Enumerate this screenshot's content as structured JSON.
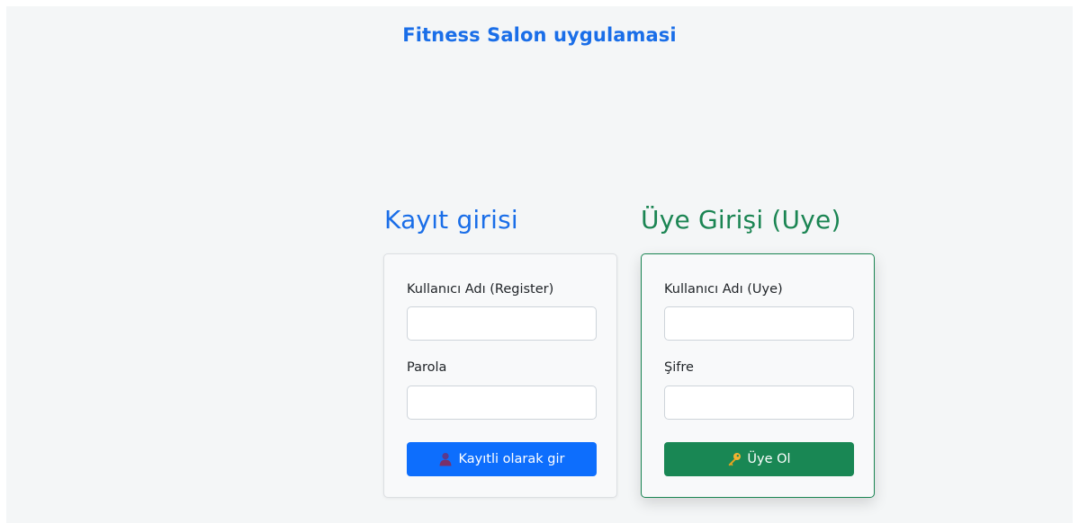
{
  "app": {
    "title": "Fitness Salon uygulamasi"
  },
  "register": {
    "heading": "Kayıt girisi",
    "username_label": "Kullanıcı Adı (Register)",
    "username_value": "",
    "password_label": "Parola",
    "password_value": "",
    "button_label": "Kayıtli olarak gir",
    "button_icon": "user-icon"
  },
  "member": {
    "heading": "Üye Girişi (Uye)",
    "username_label": "Kullanıcı Adı (Uye)",
    "username_value": "",
    "password_label": "Şifre",
    "password_value": "",
    "button_label": "Üye Ol",
    "button_icon": "key-icon"
  },
  "colors": {
    "primary_blue": "#0d6efd",
    "success_green": "#198754",
    "background": "#f4f6f7"
  }
}
